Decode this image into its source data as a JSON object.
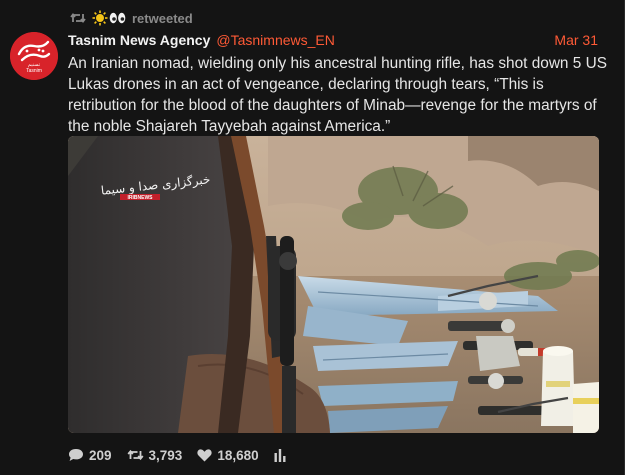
{
  "retweet": {
    "label": "retweeted",
    "icon": "retweet-icon",
    "user_emoji": [
      "sun-emoji",
      "eyes-emoji"
    ]
  },
  "author": {
    "name": "Tasnim News Agency",
    "handle": "@Tasnimnews_EN",
    "avatar_icon": "tasnim-logo",
    "avatar_text_fa": "تسنیم",
    "avatar_text_en": "Tasnim"
  },
  "tweet": {
    "date": "Mar 31",
    "text": "An Iranian nomad, wielding only his ancestral hunting rifle, has shot down 5 US Lukas drones in an act of vengeance, declaring through tears, “This is retribution for the blood of the daughters of Minab—revenge for the martyrs of the noble Shajareh Tayyebah against America.”"
  },
  "media": {
    "watermark_fa": "خبرگزاری صدا و سیما",
    "watermark_en": "IRIBNEWS"
  },
  "actions": {
    "replies": "209",
    "retweets": "3,793",
    "likes": "18,680"
  },
  "colors": {
    "background": "#141414",
    "accent": "#ff5a36",
    "text": "#e6e6e6",
    "muted": "#8a8a8a",
    "avatar_red": "#d8232a"
  }
}
